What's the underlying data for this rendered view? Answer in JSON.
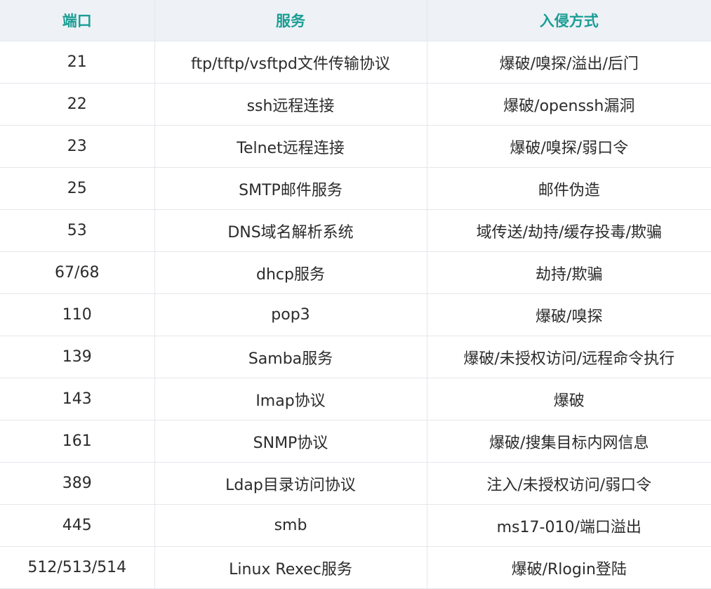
{
  "headers": {
    "port": "端口",
    "service": "服务",
    "attack": "入侵方式"
  },
  "rows": [
    {
      "port": "21",
      "service": "ftp/tftp/vsftpd文件传输协议",
      "attack": "爆破/嗅探/溢出/后门"
    },
    {
      "port": "22",
      "service": "ssh远程连接",
      "attack": "爆破/openssh漏洞"
    },
    {
      "port": "23",
      "service": "Telnet远程连接",
      "attack": "爆破/嗅探/弱口令"
    },
    {
      "port": "25",
      "service": "SMTP邮件服务",
      "attack": "邮件伪造"
    },
    {
      "port": "53",
      "service": "DNS域名解析系统",
      "attack": "域传送/劫持/缓存投毒/欺骗"
    },
    {
      "port": "67/68",
      "service": "dhcp服务",
      "attack": "劫持/欺骗"
    },
    {
      "port": "110",
      "service": "pop3",
      "attack": "爆破/嗅探"
    },
    {
      "port": "139",
      "service": "Samba服务",
      "attack": "爆破/未授权访问/远程命令执行"
    },
    {
      "port": "143",
      "service": "Imap协议",
      "attack": "爆破"
    },
    {
      "port": "161",
      "service": "SNMP协议",
      "attack": "爆破/搜集目标内网信息"
    },
    {
      "port": "389",
      "service": "Ldap目录访问协议",
      "attack": "注入/未授权访问/弱口令"
    },
    {
      "port": "445",
      "service": "smb",
      "attack": "ms17-010/端口溢出"
    },
    {
      "port": "512/513/514",
      "service": "Linux Rexec服务",
      "attack": "爆破/Rlogin登陆"
    }
  ]
}
